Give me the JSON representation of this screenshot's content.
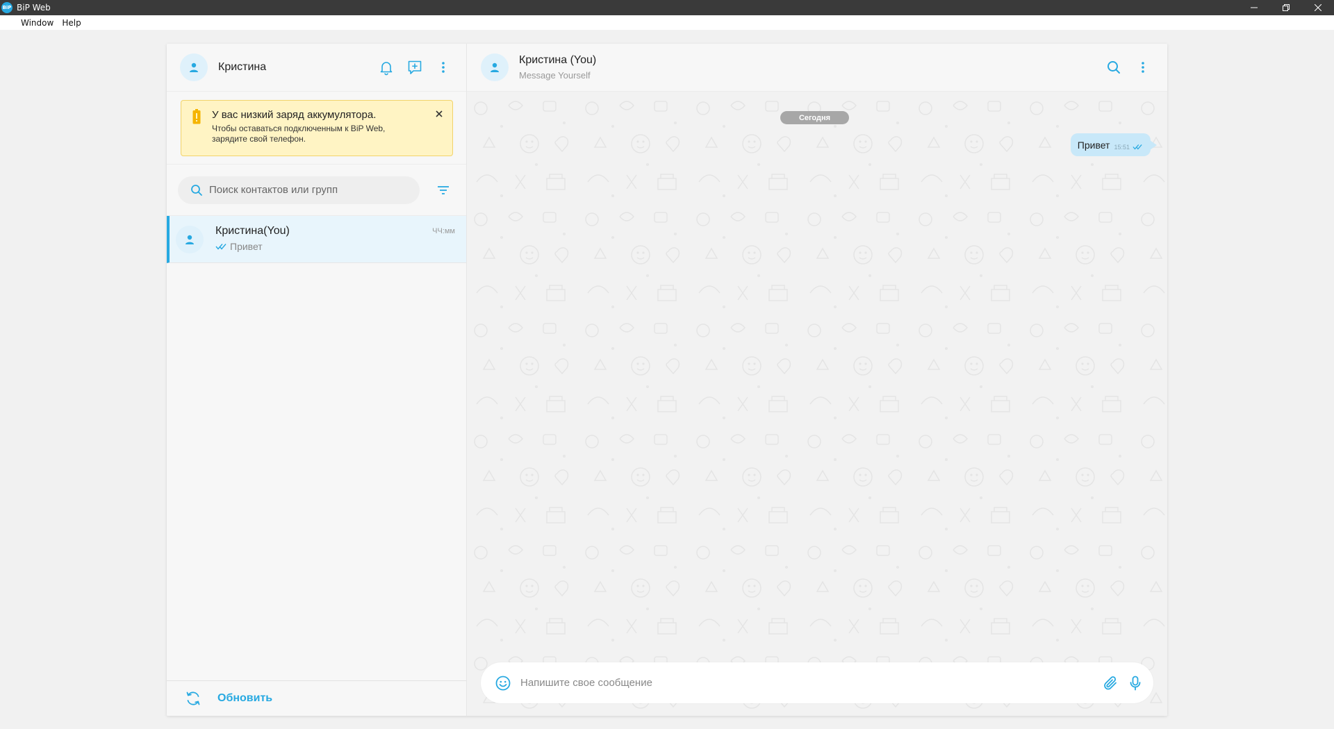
{
  "window": {
    "title": "BiP Web",
    "logo_text": "BiP"
  },
  "menubar": {
    "items": [
      "Window",
      "Help"
    ]
  },
  "sidebar": {
    "profile_name": "Кристина",
    "alert": {
      "title": "У вас низкий заряд аккумулятора.",
      "text": "Чтобы оставаться подключенным к BiP Web, зарядите свой телефон."
    },
    "search": {
      "placeholder": "Поиск контактов или групп"
    },
    "chats": [
      {
        "name": "Кристина(You)",
        "preview": "Привет",
        "time": "ЧЧ:мм"
      }
    ],
    "footer": {
      "refresh_label": "Обновить"
    }
  },
  "chat": {
    "title": "Кристина (You)",
    "subtitle": "Message Yourself",
    "date_label": "Сегодня",
    "messages": [
      {
        "text": "Привет",
        "time": "15:51"
      }
    ],
    "composer": {
      "placeholder": "Напишите свое сообщение"
    }
  },
  "colors": {
    "accent": "#27a9e1",
    "bubble": "#c8e8f9",
    "alert_bg": "#fff4c4",
    "alert_border": "#f2d36a",
    "title_bar": "#3a3a3a"
  }
}
